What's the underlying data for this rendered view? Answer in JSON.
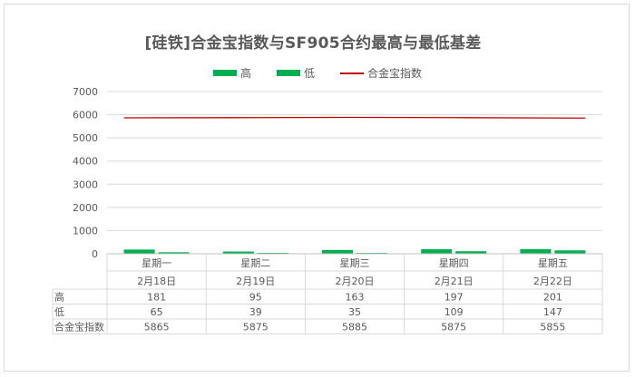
{
  "chart_data": {
    "type": "bar",
    "title": "[硅铁]合金宝指数与SF905合约最高与最低基差",
    "categories": [
      "星期一",
      "星期二",
      "星期三",
      "星期四",
      "星期五"
    ],
    "sub_categories": [
      "2月18日",
      "2月19日",
      "2月20日",
      "2月21日",
      "2月22日"
    ],
    "series": [
      {
        "name": "高",
        "kind": "bar",
        "color": "#00b050",
        "values": [
          181,
          95,
          163,
          197,
          201
        ]
      },
      {
        "name": "低",
        "kind": "bar",
        "color": "#00b050",
        "values": [
          65,
          39,
          35,
          109,
          147
        ]
      },
      {
        "name": "合金宝指数",
        "kind": "line",
        "color": "#c00000",
        "values": [
          5865,
          5875,
          5885,
          5875,
          5855
        ]
      }
    ],
    "ylim": [
      0,
      7000
    ],
    "yticks": [
      0,
      1000,
      2000,
      3000,
      4000,
      5000,
      6000,
      7000
    ],
    "grid": true,
    "legend_position": "top-center",
    "data_table": true
  }
}
